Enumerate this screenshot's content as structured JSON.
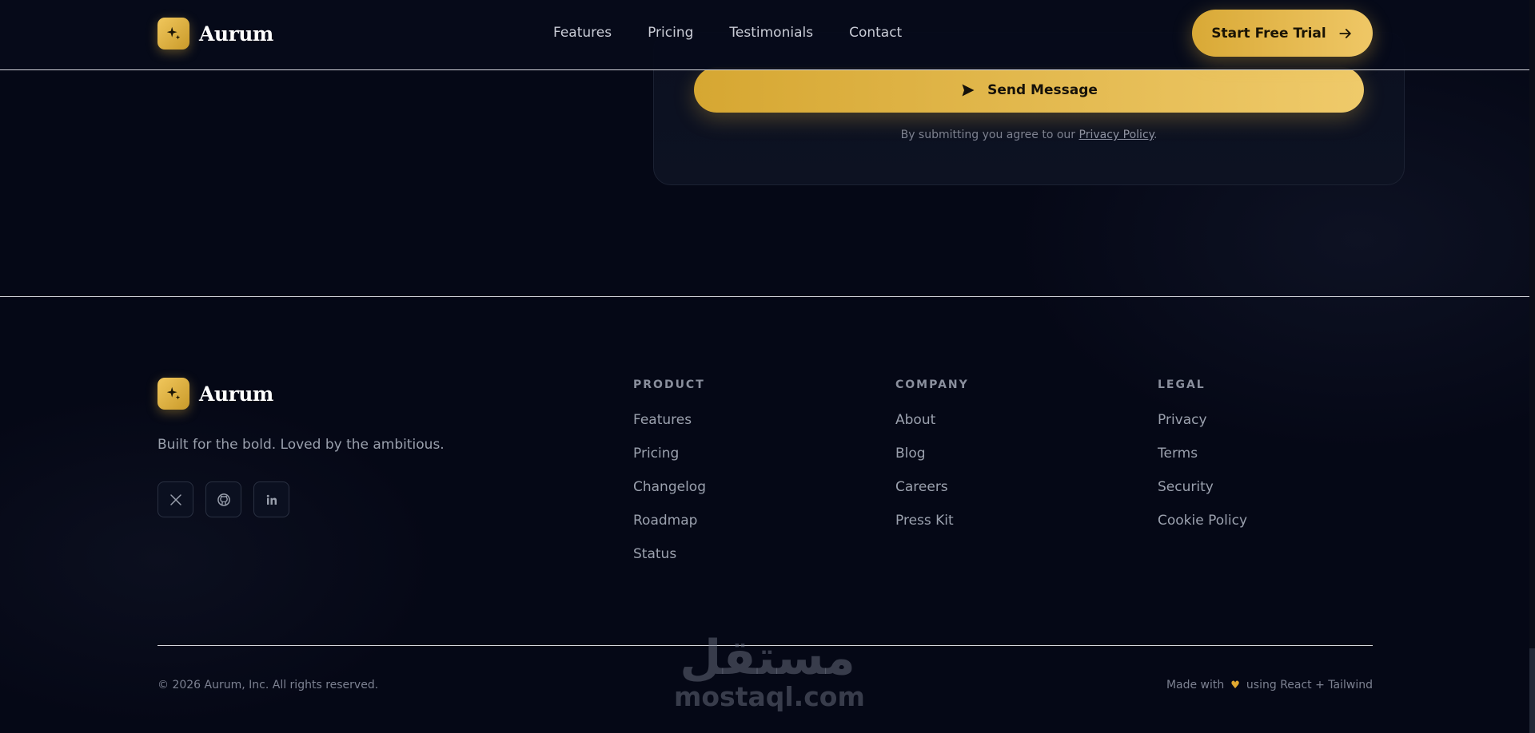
{
  "brand": {
    "name": "Aurum"
  },
  "nav": {
    "items": [
      "Features",
      "Pricing",
      "Testimonials",
      "Contact"
    ],
    "cta_label": "Start Free Trial"
  },
  "contact_form": {
    "submit_label": "Send Message",
    "consent_prefix": "By submitting you agree to our ",
    "consent_link": "Privacy Policy",
    "consent_suffix": "."
  },
  "footer": {
    "tagline": "Built for the bold. Loved by the ambitious.",
    "socials": [
      "x-icon",
      "github-icon",
      "linkedin-icon"
    ],
    "columns": [
      {
        "title": "PRODUCT",
        "links": [
          "Features",
          "Pricing",
          "Changelog",
          "Roadmap",
          "Status"
        ]
      },
      {
        "title": "COMPANY",
        "links": [
          "About",
          "Blog",
          "Careers",
          "Press Kit"
        ]
      },
      {
        "title": "LEGAL",
        "links": [
          "Privacy",
          "Terms",
          "Security",
          "Cookie Policy"
        ]
      }
    ],
    "copyright": "© 2026 Aurum, Inc. All rights reserved.",
    "made_with_prefix": "Made with",
    "made_with_suffix": "using React + Tailwind"
  },
  "watermark": {
    "arabic": "مستقل",
    "latin": "mostaql.com"
  },
  "colors": {
    "background": "#050816",
    "accent": "#e9b840",
    "accent_light": "#f1c75c"
  }
}
